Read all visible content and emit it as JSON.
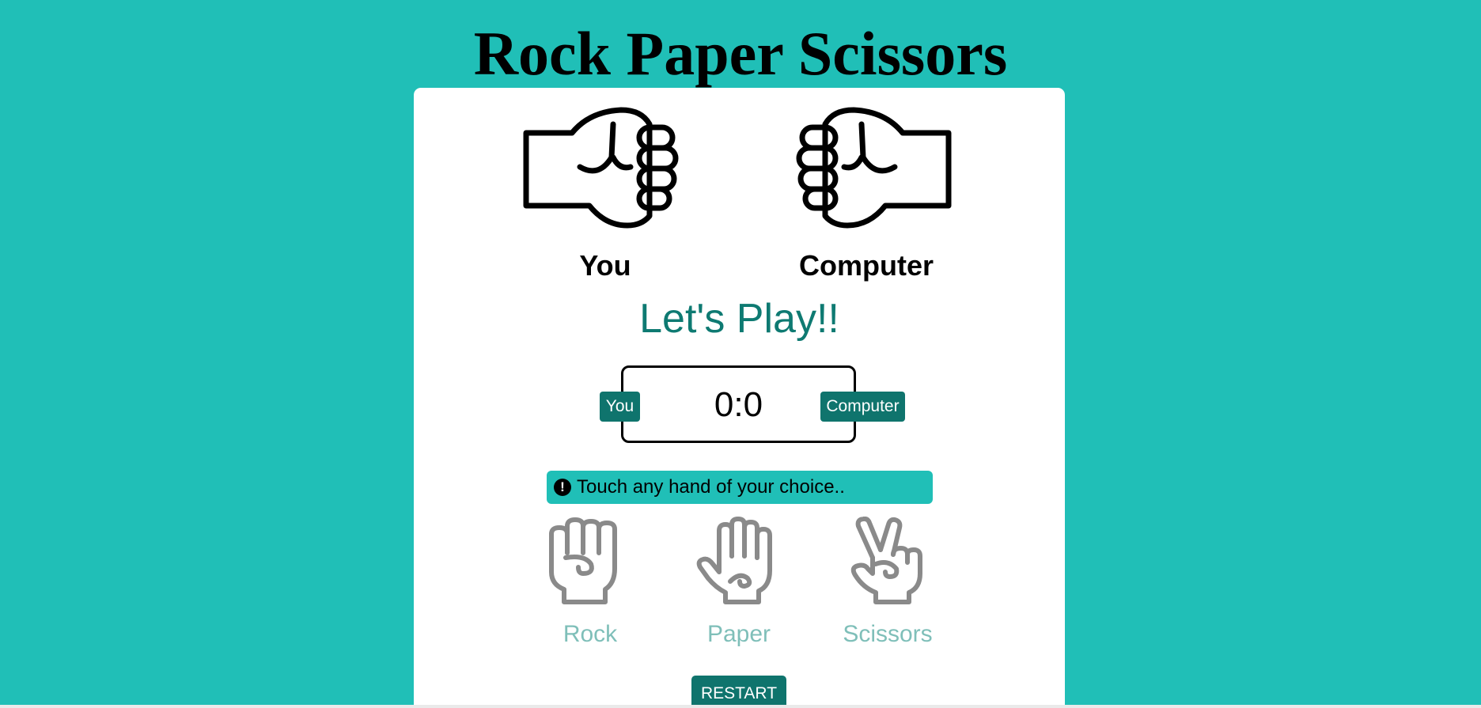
{
  "page": {
    "title": "Rock Paper Scissors"
  },
  "colors": {
    "background": "#20bfb7",
    "card": "#ffffff",
    "accent": "#0f746d",
    "status_text": "#0e7a72",
    "choice_label": "#7fbfb9",
    "choice_icon": "#8a8a8a"
  },
  "arena": {
    "player_hand_icon": "fist-icon",
    "computer_hand_icon": "fist-icon",
    "player_label": "You",
    "computer_label": "Computer"
  },
  "status": {
    "message": "Let's Play!!"
  },
  "scoreboard": {
    "score": "0:0",
    "player_tag": "You",
    "computer_tag": "Computer"
  },
  "hint": {
    "icon": "exclamation-circle-icon",
    "text": "Touch any hand of your choice.."
  },
  "choices": [
    {
      "label": "Rock",
      "icon": "rock-hand-icon"
    },
    {
      "label": "Paper",
      "icon": "paper-hand-icon"
    },
    {
      "label": "Scissors",
      "icon": "scissors-hand-icon"
    }
  ],
  "controls": {
    "restart_label": "RESTART"
  }
}
